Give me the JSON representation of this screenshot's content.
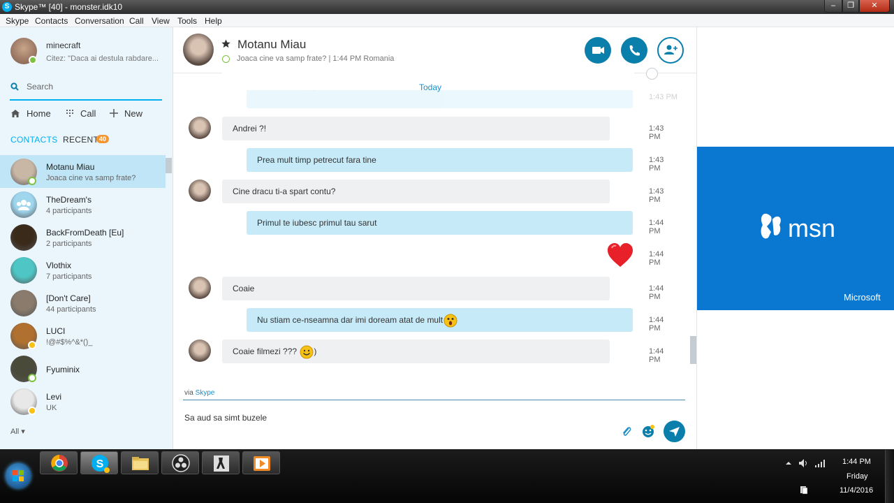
{
  "window": {
    "title": "Skype™ [40] - monster.idk10",
    "min": "‒",
    "max": "❐",
    "close": "✕"
  },
  "menu": [
    "Skype",
    "Contacts",
    "Conversation",
    "Call",
    "View",
    "Tools",
    "Help"
  ],
  "profile": {
    "name": "minecraft",
    "mood": "Citez:  \"Daca ai destula rabdare..."
  },
  "search": {
    "placeholder": "Search"
  },
  "nav": {
    "home": "Home",
    "call": "Call",
    "new": "New"
  },
  "tabs": {
    "contacts": "CONTACTS",
    "recent": "RECENT",
    "recent_count": "40"
  },
  "contacts": [
    {
      "name": "Motanu Miau",
      "sub": "Joaca cine va samp frate?",
      "presence": "white",
      "color": "#c9b7a6"
    },
    {
      "name": "TheDream's",
      "sub": "4 participants",
      "presence": "",
      "color": "#9fd6ee"
    },
    {
      "name": "BackFromDeath [Eu]",
      "sub": "2 participants",
      "presence": "",
      "color": "#3a2a1a"
    },
    {
      "name": "Vlothix",
      "sub": "7 participants",
      "presence": "",
      "color": "#4fc6c6"
    },
    {
      "name": "[Don't Care]",
      "sub": "44 participants",
      "presence": "",
      "color": "#8a7b6c"
    },
    {
      "name": "LUCI",
      "sub": "!@#$%^&*()_",
      "presence": "yellow",
      "color": "#b07030"
    },
    {
      "name": "Fyuminix",
      "sub": "",
      "presence": "white",
      "color": "#4a4a3a"
    },
    {
      "name": "Levi",
      "sub": "UK",
      "presence": "yellow",
      "color": "#e8e8e8"
    }
  ],
  "all_label": "All ▾",
  "chat": {
    "name": "Motanu Miau",
    "status": "Joaca cine va samp frate?  |  1:44 PM Romania",
    "date_divider": "Today",
    "partial_message": "Prea mult timp petrecut fara tine",
    "messages": [
      {
        "dir": "in",
        "text": "Andrei ?!",
        "time": "1:43 PM",
        "avatar": true
      },
      {
        "dir": "out",
        "text": "Prea mult timp petrecut fara tine",
        "time": "1:43 PM"
      },
      {
        "dir": "in",
        "text": "Cine dracu ti-a spart contu?",
        "time": "1:43 PM",
        "avatar": true
      },
      {
        "dir": "out",
        "text": "Primul te iubesc primul tau sarut",
        "time": "1:44 PM"
      },
      {
        "dir": "emoticon",
        "text": "",
        "time": "1:44 PM"
      },
      {
        "dir": "in",
        "text": "Coaie",
        "time": "1:44 PM",
        "avatar": true
      },
      {
        "dir": "out",
        "text": "Nu stiam ce-nseamna dar imi doream atat de mult",
        "time": "1:44 PM",
        "emoji": "surprised"
      },
      {
        "dir": "in",
        "text": "Coaie filmezi ??? ",
        "time": "1:44 PM",
        "avatar": true,
        "emoji": "smile",
        "suffix": ")"
      }
    ],
    "partial_time": "1:43 PM"
  },
  "compose": {
    "via_prefix": "via",
    "via_link": "Skype",
    "text": "Sa aud sa simt buzele"
  },
  "ad": {
    "brand": "msn",
    "company": "Microsoft"
  },
  "taskbar": {
    "time": "1:44 PM",
    "day": "Friday",
    "date": "11/4/2016"
  },
  "colors": {
    "skype_blue": "#00aff0",
    "button_blue": "#0b7fab",
    "ad_blue": "#0a78d1",
    "incoming": "#eef0f2",
    "outgoing": "#c6eaf8"
  }
}
